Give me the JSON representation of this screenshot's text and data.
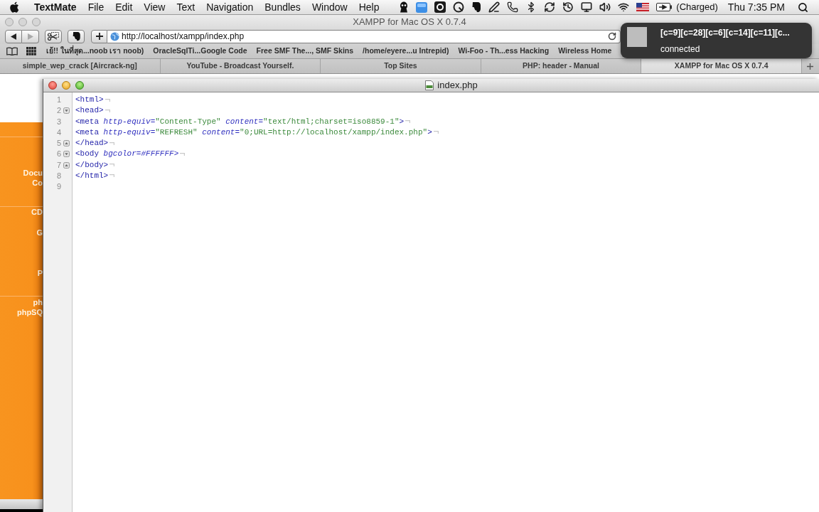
{
  "menu_bar": {
    "app_name": "TextMate",
    "menus": [
      "File",
      "Edit",
      "View",
      "Text",
      "Navigation",
      "Bundles",
      "Window",
      "Help"
    ],
    "battery_status": "(Charged)",
    "clock": "Thu 7:35 PM"
  },
  "browser": {
    "title": "XAMPP for Mac OS X 0.7.4",
    "forward_disabled": true,
    "address": "http://localhost/xampp/index.php",
    "bookmarks": [
      "เย้!! ในที่สุด...noob เรา noob)",
      "OracleSqlTi...Google Code",
      "Free SMF The..., SMF Skins",
      "/home/eyere...u Intrepid)",
      "Wi-Foo - Th...ess Hacking",
      "Wireless Home"
    ],
    "tabs": [
      {
        "label": "simple_wep_crack [Aircrack-ng]",
        "selected": false
      },
      {
        "label": "YouTube - Broadcast Yourself.",
        "selected": false
      },
      {
        "label": "Top Sites",
        "selected": false
      },
      {
        "label": "PHP: header - Manual",
        "selected": false
      },
      {
        "label": "XAMPP for Mac OS X 0.7.4",
        "selected": true
      }
    ],
    "page_sidebar": {
      "sections": [
        [
          "Docu",
          "Co"
        ],
        [
          "CD",
          "G",
          "P"
        ],
        [
          "ph",
          "phpSQ"
        ]
      ]
    }
  },
  "notification": {
    "title": "[c=9][c=28][c=6][c=14][c=11][c...",
    "message": "connected"
  },
  "editor": {
    "title": "index.php",
    "lines": [
      {
        "number": "1",
        "kind": "plain",
        "tokens": [
          {
            "kind": "tag",
            "text": "<html>"
          }
        ]
      },
      {
        "number": "2",
        "kind": "fold_start",
        "tokens": [
          {
            "kind": "tag",
            "text": "<head>"
          }
        ]
      },
      {
        "number": "3",
        "kind": "plain",
        "tokens": [
          {
            "kind": "tag",
            "text": "<meta"
          },
          {
            "kind": "attribute",
            "text": " http-equiv="
          },
          {
            "kind": "string",
            "text": "\"Content-Type\""
          },
          {
            "kind": "attribute",
            "text": " content="
          },
          {
            "kind": "string",
            "text": "\"text/html;charset=iso8859-1\""
          },
          {
            "kind": "tag",
            "text": ">"
          }
        ]
      },
      {
        "number": "4",
        "kind": "plain",
        "tokens": [
          {
            "kind": "tag",
            "text": "<meta"
          },
          {
            "kind": "attribute",
            "text": " http-equiv="
          },
          {
            "kind": "string",
            "text": "\"REFRESH\""
          },
          {
            "kind": "attribute",
            "text": " content="
          },
          {
            "kind": "string",
            "text": "\"0;URL=http://localhost/xampp/index.php\""
          },
          {
            "kind": "tag",
            "text": ">"
          }
        ]
      },
      {
        "number": "5",
        "kind": "fold_end",
        "tokens": [
          {
            "kind": "tag",
            "text": "</head>"
          }
        ]
      },
      {
        "number": "6",
        "kind": "fold_start",
        "tokens": [
          {
            "kind": "tag",
            "text": "<body"
          },
          {
            "kind": "attribute",
            "text": " bgcolor=#FFFFFF>"
          }
        ]
      },
      {
        "number": "7",
        "kind": "fold_end",
        "tokens": [
          {
            "kind": "tag",
            "text": "</body>"
          }
        ]
      },
      {
        "number": "8",
        "kind": "plain",
        "tokens": [
          {
            "kind": "tag",
            "text": "</html>"
          }
        ]
      },
      {
        "number": "9",
        "kind": "plain"
      }
    ]
  }
}
